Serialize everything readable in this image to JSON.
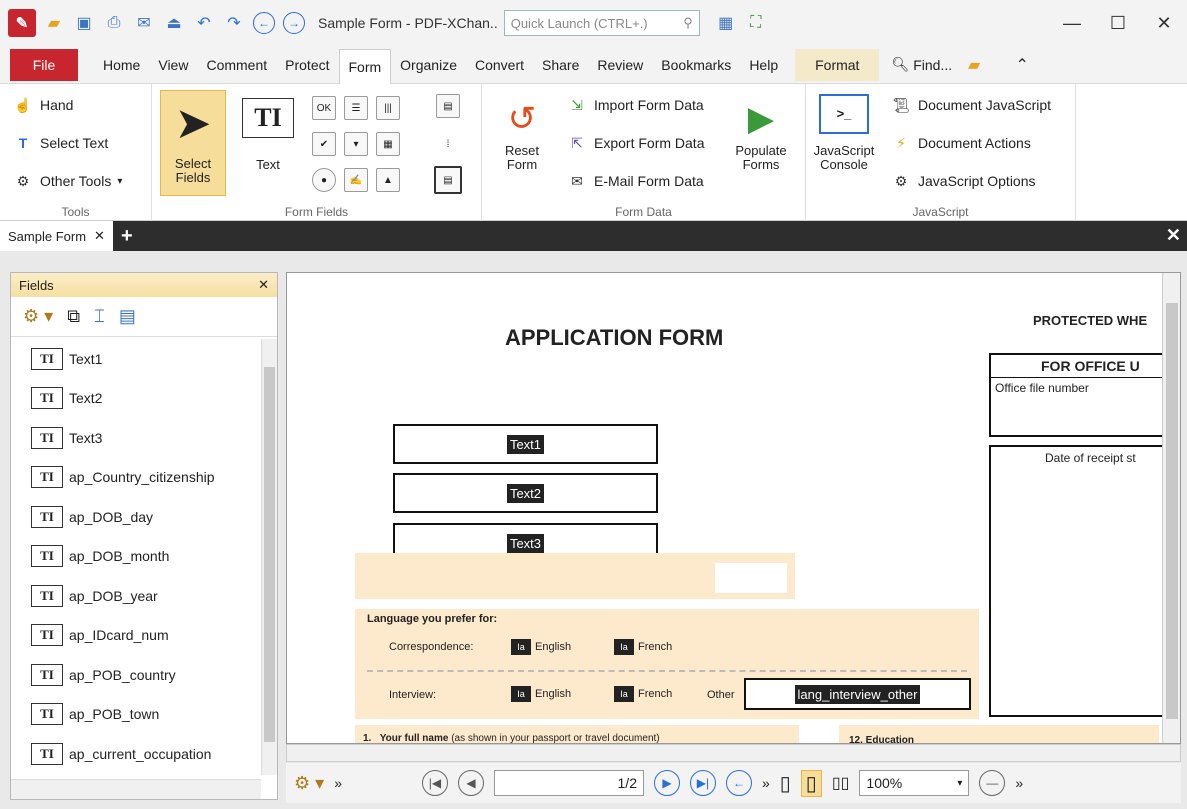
{
  "titlebar": {
    "title": "Sample Form - PDF-XChan..",
    "quick_launch_placeholder": "Quick Launch (CTRL+.)"
  },
  "menu": {
    "file": "File",
    "tabs": [
      "Home",
      "View",
      "Comment",
      "Protect",
      "Form",
      "Organize",
      "Convert",
      "Share",
      "Review",
      "Bookmarks",
      "Help"
    ],
    "format": "Format",
    "find": "Find..."
  },
  "ribbon": {
    "tools": {
      "hand": "Hand",
      "select_text": "Select Text",
      "other_tools": "Other Tools",
      "label": "Tools"
    },
    "select_fields": {
      "line1": "Select",
      "line2": "Fields"
    },
    "form_fields": {
      "text": "Text",
      "label": "Form Fields",
      "ok": "OK"
    },
    "form_data": {
      "reset_line1": "Reset",
      "reset_line2": "Form",
      "import": "Import Form Data",
      "export": "Export Form Data",
      "email": "E-Mail Form Data",
      "populate_line1": "Populate",
      "populate_line2": "Forms",
      "label": "Form Data"
    },
    "javascript": {
      "console_line1": "JavaScript",
      "console_line2": "Console",
      "document_js": "Document JavaScript",
      "document_actions": "Document Actions",
      "js_options": "JavaScript Options",
      "label": "JavaScript"
    }
  },
  "doctab": {
    "name": "Sample Form"
  },
  "fields_panel": {
    "title": "Fields",
    "items": [
      "Text1",
      "Text2",
      "Text3",
      "ap_Country_citizenship",
      "ap_DOB_day",
      "ap_DOB_month",
      "ap_DOB_year",
      "ap_IDcard_num",
      "ap_POB_country",
      "ap_POB_town",
      "ap_current_occupation"
    ]
  },
  "document": {
    "heading": "APPLICATION FORM",
    "protected": "PROTECTED WHE",
    "office_use": "FOR OFFICE U",
    "office_file": "Office file number",
    "date_receipt": "Date of receipt st",
    "fields": [
      "Text1",
      "Text2",
      "Text3"
    ],
    "lang_title": "Language you prefer for:",
    "correspondence": "Correspondence:",
    "interview": "Interview:",
    "english": "English",
    "french": "French",
    "other": "Other",
    "other_field": "lang_interview_other",
    "full_name_num": "1.",
    "full_name_bold": "Your full name",
    "full_name_rest": "(as shown in your passport or travel document)",
    "education": "12. Education"
  },
  "statusbar": {
    "page": "1/2",
    "zoom": "100%"
  }
}
